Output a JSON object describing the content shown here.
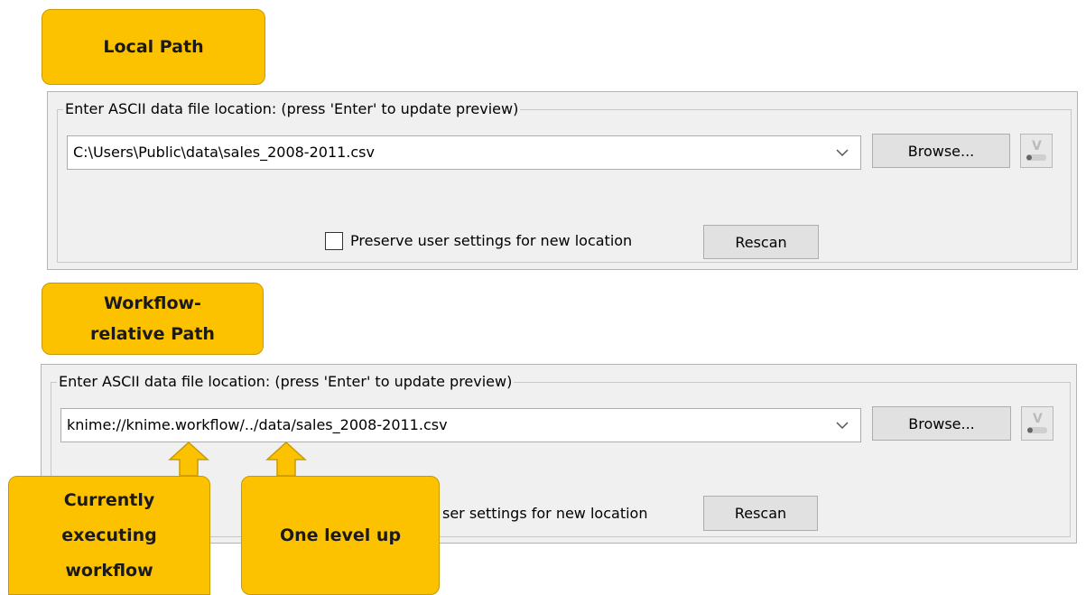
{
  "callouts": {
    "local": "Local Path",
    "relative_line1": "Workflow-",
    "relative_line2": "relative Path",
    "current_line1": "Currently",
    "current_line2": "executing",
    "current_line3": "workflow",
    "one_level": "One level up"
  },
  "panel1": {
    "legend": "Enter ASCII data file location: (press 'Enter' to update preview)",
    "path": "C:\\Users\\Public\\data\\sales_2008-2011.csv",
    "browse": "Browse...",
    "preserve": "Preserve user settings for new location",
    "preserve_checked": false,
    "rescan": "Rescan"
  },
  "panel2": {
    "legend": "Enter ASCII data file location: (press 'Enter' to update preview)",
    "path": "knime://knime.workflow/../data/sales_2008-2011.csv",
    "browse": "Browse...",
    "preserve_visible": "ser settings for new location",
    "rescan": "Rescan"
  },
  "icons": {
    "dropdown": "chevron-down-icon",
    "flow_variable": "flow-variable-icon",
    "arrow": "arrow-up-icon"
  },
  "colors": {
    "callout_fill": "#fcc200",
    "callout_border": "#c99a00",
    "panel_bg": "#f0f0f0"
  }
}
